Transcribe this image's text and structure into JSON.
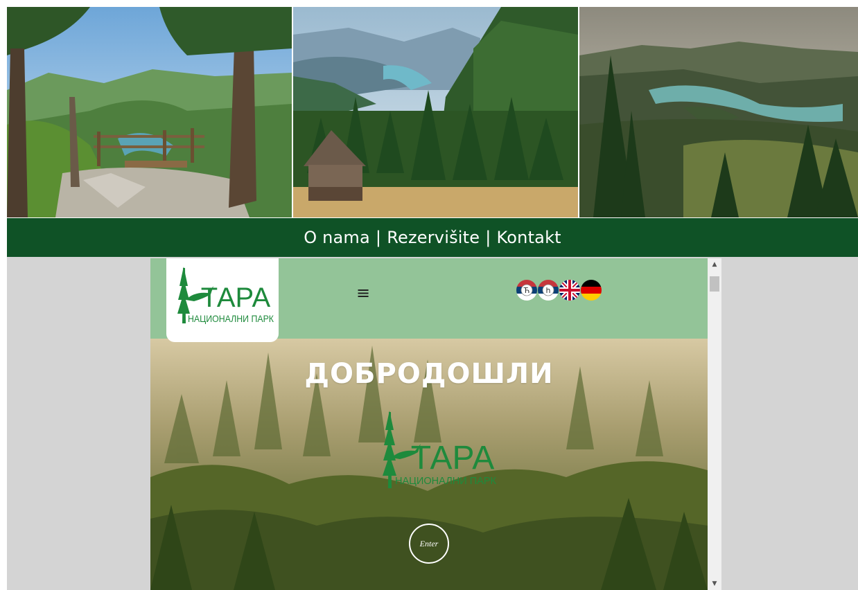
{
  "nav": {
    "links": [
      "O nama",
      "Rezervišite",
      "Kontakt"
    ],
    "separator": "|"
  },
  "photos": [
    {
      "subject": "viewpoint with wooden fence over canyon"
    },
    {
      "subject": "wooden hut in pine forest with lake valley"
    },
    {
      "subject": "lake among forested hills"
    }
  ],
  "embed": {
    "logo": {
      "title": "ТАРА",
      "subtitle": "НАЦИОНАЛНИ ПАРК"
    },
    "menu_icon": "hamburger-icon",
    "menu_glyph": "≡",
    "flags": [
      {
        "name": "serbian-cyrillic-flag-icon",
        "badge": "Ћ"
      },
      {
        "name": "serbian-latin-flag-icon",
        "badge": "h"
      },
      {
        "name": "uk-flag-icon"
      },
      {
        "name": "german-flag-icon"
      }
    ],
    "hero": {
      "title": "ДОБРОДОШЛИ",
      "logo_title": "ТАРА",
      "logo_subtitle": "НАЦИОНАЛНИ ПАРК",
      "enter_label": "Enter"
    },
    "scrollbar": {
      "up": "▲",
      "down": "▼"
    }
  },
  "colors": {
    "nav_green": "#0f5226",
    "header_green": "#93c498",
    "logo_green": "#1e8a3c",
    "grey_bg": "#d4d4d4"
  }
}
